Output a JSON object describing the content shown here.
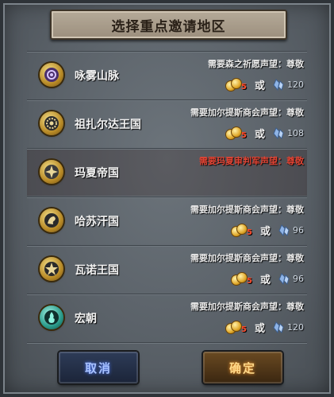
{
  "title": "选择重点邀请地区",
  "regions": [
    {
      "name": "咏雾山脉",
      "requirement": "需要森之祈愿声望：尊敬",
      "coin_amount": "5",
      "or_label": "或",
      "crystal_amount": "120",
      "locked": false,
      "emblem": "spiral-emblem-icon"
    },
    {
      "name": "祖扎尔达王国",
      "requirement": "需要加尔提斯商会声望：尊敬",
      "coin_amount": "5",
      "or_label": "或",
      "crystal_amount": "108",
      "locked": false,
      "emblem": "sun-gear-emblem-icon"
    },
    {
      "name": "玛夏帝国",
      "requirement": "需要玛夏审判军声望：尊敬",
      "coin_amount": "",
      "or_label": "",
      "crystal_amount": "",
      "locked": true,
      "emblem": "cross-emblem-icon"
    },
    {
      "name": "哈苏汗国",
      "requirement": "需要加尔提斯商会声望：尊敬",
      "coin_amount": "5",
      "or_label": "或",
      "crystal_amount": "96",
      "locked": false,
      "emblem": "beast-emblem-icon"
    },
    {
      "name": "瓦诺王国",
      "requirement": "需要加尔提斯商会声望：尊敬",
      "coin_amount": "5",
      "or_label": "或",
      "crystal_amount": "96",
      "locked": false,
      "emblem": "star-emblem-icon"
    },
    {
      "name": "宏朝",
      "requirement": "需要加尔提斯商会声望：尊敬",
      "coin_amount": "5",
      "or_label": "或",
      "crystal_amount": "120",
      "locked": false,
      "emblem": "flame-emblem-icon"
    }
  ],
  "buttons": {
    "cancel": "取消",
    "confirm": "确定"
  },
  "colors": {
    "locked_text": "#e04434",
    "coin_number": "#ff4a2a"
  }
}
